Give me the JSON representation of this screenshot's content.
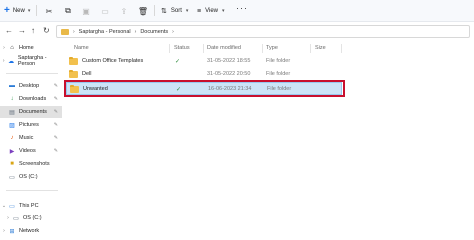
{
  "toolbar": {
    "new_label": "New",
    "sort_label": "Sort",
    "view_label": "View",
    "more_label": "···"
  },
  "address": {
    "path": [
      "Saptargha - Personal",
      "Documents"
    ]
  },
  "sidebar": {
    "home": "Home",
    "cloud": "Saptargha - Person",
    "items": [
      {
        "label": "Desktop",
        "icon": "desktop-icon"
      },
      {
        "label": "Downloads",
        "icon": "downloads-icon"
      },
      {
        "label": "Documents",
        "icon": "documents-icon"
      },
      {
        "label": "Pictures",
        "icon": "pictures-icon"
      },
      {
        "label": "Music",
        "icon": "music-icon"
      },
      {
        "label": "Videos",
        "icon": "videos-icon"
      },
      {
        "label": "Screenshots",
        "icon": "screenshots-icon"
      },
      {
        "label": "OS (C:)",
        "icon": "drive-icon"
      }
    ],
    "this_pc": "This PC",
    "pc_drive": "OS (C:)",
    "network": "Network"
  },
  "columns": {
    "name": "Name",
    "status": "Status",
    "date": "Date modified",
    "type": "Type",
    "size": "Size"
  },
  "files": [
    {
      "name": "Custom Office Templates",
      "date": "31-05-2022 18:55",
      "type": "File folder"
    },
    {
      "name": "Dell",
      "date": "31-05-2022 20:50",
      "type": "File folder"
    },
    {
      "name": "Unwanted",
      "date": "16-06-2023 21:34",
      "type": "File folder"
    }
  ],
  "colors": {
    "accent": "#1a73e8",
    "selection": "#cce4f7",
    "highlight": "#c8102e",
    "folder": "#f2c14e"
  }
}
